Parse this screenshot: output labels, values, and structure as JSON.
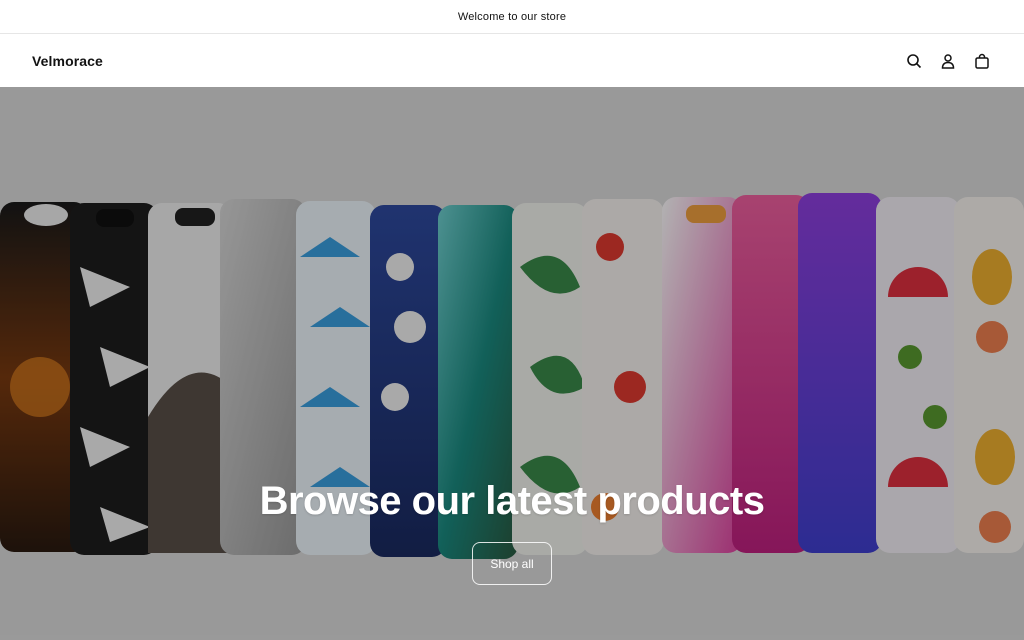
{
  "announcement": {
    "text": "Welcome to our store"
  },
  "header": {
    "logo": "Velmorace",
    "icons": [
      "search-icon",
      "account-icon",
      "cart-icon"
    ]
  },
  "hero": {
    "title": "Browse our latest products",
    "button_label": "Shop all",
    "overlay_color": "#000000"
  },
  "colors": {
    "background": "#ffffff",
    "text": "#121212",
    "divider": "#e6e6e6"
  }
}
